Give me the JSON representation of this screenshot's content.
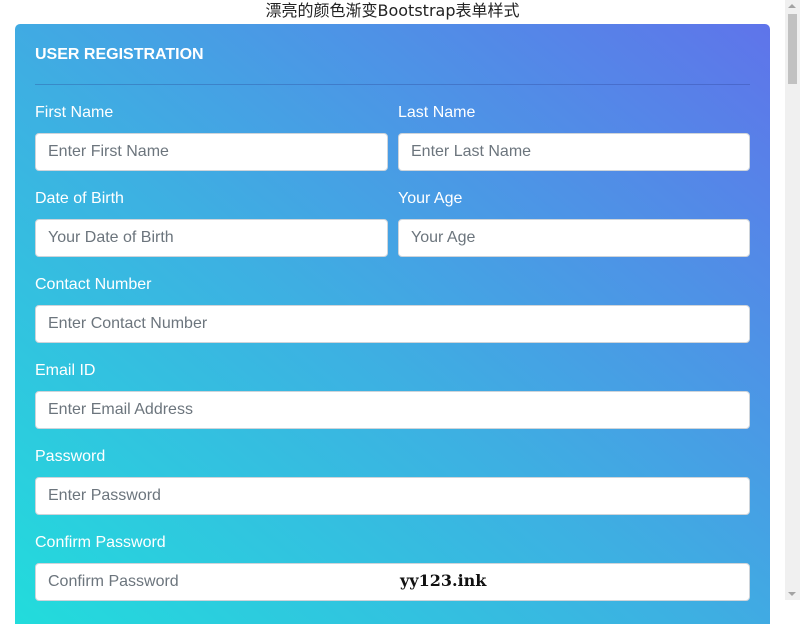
{
  "page": {
    "title": "漂亮的颜色渐变Bootstrap表单样式"
  },
  "form": {
    "title": "USER REGISTRATION",
    "fields": {
      "first_name": {
        "label": "First Name",
        "placeholder": "Enter First Name",
        "value": ""
      },
      "last_name": {
        "label": "Last Name",
        "placeholder": "Enter Last Name",
        "value": ""
      },
      "dob": {
        "label": "Date of Birth",
        "placeholder": "Your Date of Birth",
        "value": ""
      },
      "age": {
        "label": "Your Age",
        "placeholder": "Your Age",
        "value": ""
      },
      "contact": {
        "label": "Contact Number",
        "placeholder": "Enter Contact Number",
        "value": ""
      },
      "email": {
        "label": "Email ID",
        "placeholder": "Enter Email Address",
        "value": ""
      },
      "password": {
        "label": "Password",
        "placeholder": "Enter Password",
        "value": ""
      },
      "confirm_password": {
        "label": "Confirm Password",
        "placeholder": "Confirm Password",
        "value": ""
      }
    }
  },
  "watermark": "yy123.ink",
  "colors": {
    "gradient_start": "#22dcdc",
    "gradient_mid": "#3db0e2",
    "gradient_end": "#5f74ea"
  }
}
